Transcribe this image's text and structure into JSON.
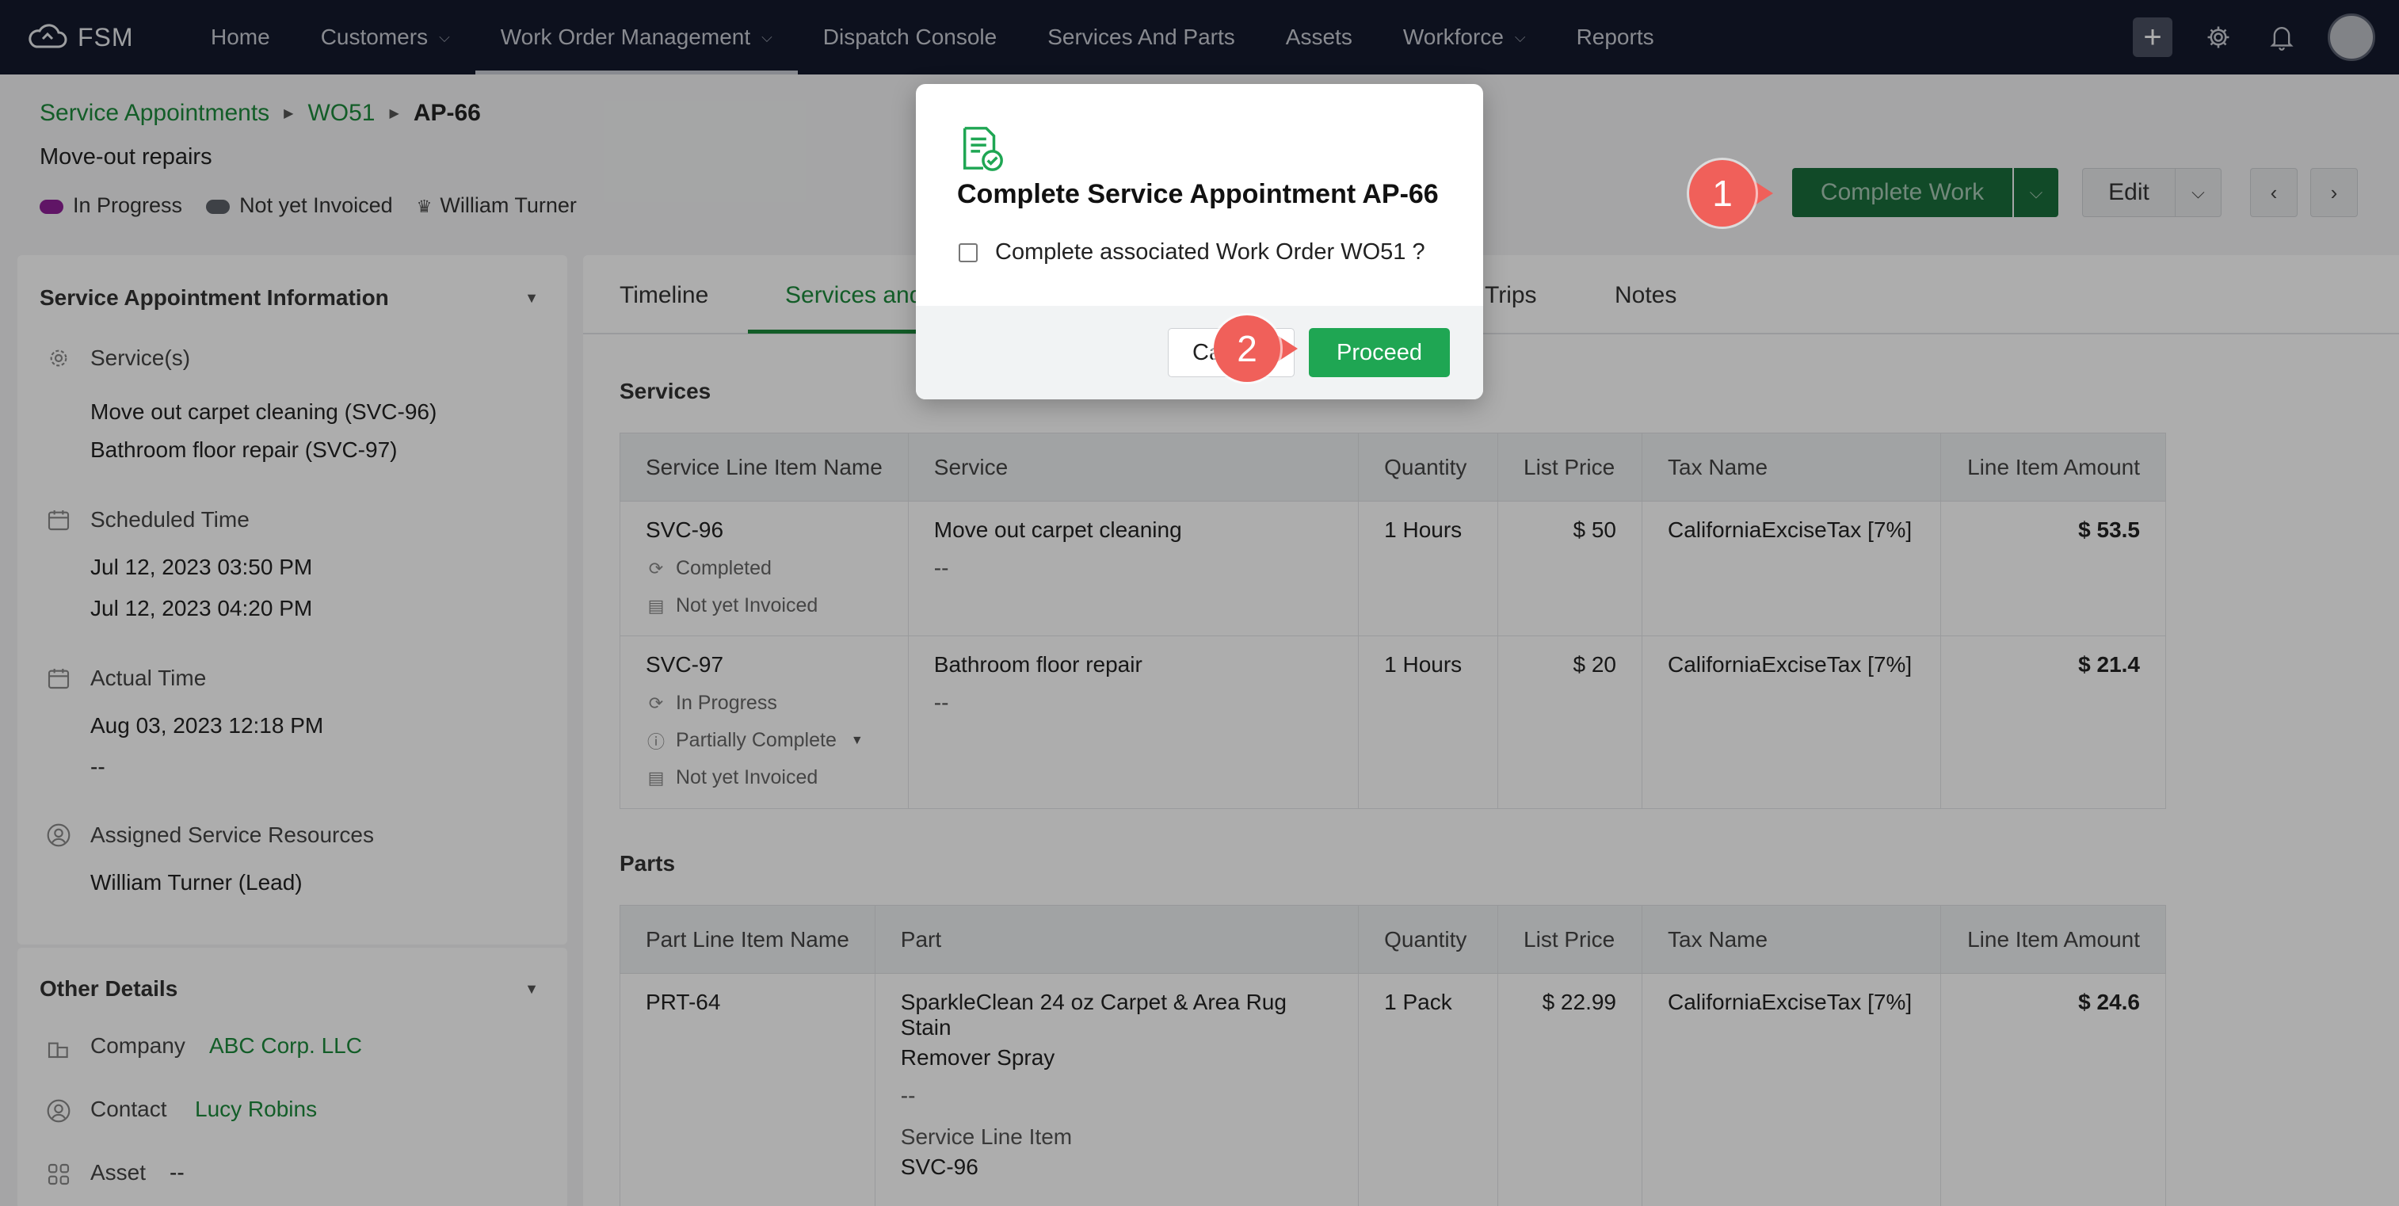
{
  "app": {
    "name": "FSM"
  },
  "nav": {
    "items": [
      {
        "label": "Home",
        "dropdown": false
      },
      {
        "label": "Customers",
        "dropdown": true
      },
      {
        "label": "Work Order Management",
        "dropdown": true,
        "active": true
      },
      {
        "label": "Dispatch Console",
        "dropdown": false
      },
      {
        "label": "Services And Parts",
        "dropdown": false
      },
      {
        "label": "Assets",
        "dropdown": false
      },
      {
        "label": "Workforce",
        "dropdown": true
      },
      {
        "label": "Reports",
        "dropdown": false
      }
    ],
    "plus_label": "+"
  },
  "breadcrumb": {
    "level1": "Service Appointments",
    "level2": "WO51",
    "current": "AP-66"
  },
  "header": {
    "subtitle": "Move-out repairs",
    "status": [
      {
        "label": "In Progress",
        "color": "#8e1f97"
      },
      {
        "label": "Not yet Invoiced",
        "color": "#5c6068"
      }
    ],
    "owner": "William Turner"
  },
  "actions": {
    "complete_work": "Complete Work",
    "edit": "Edit",
    "callout1": "1",
    "callout2": "2"
  },
  "left": {
    "section_title": "Service Appointment Information",
    "services_label": "Service(s)",
    "services": [
      "Move out carpet cleaning (SVC-96)",
      "Bathroom floor repair (SVC-97)"
    ],
    "scheduled_label": "Scheduled Time",
    "scheduled": [
      "Jul 12, 2023 03:50 PM",
      "Jul 12, 2023 04:20 PM"
    ],
    "actual_label": "Actual Time",
    "actual": [
      "Aug 03, 2023 12:18 PM",
      "--"
    ],
    "resources_label": "Assigned Service Resources",
    "resources": "William Turner (Lead)",
    "other_title": "Other Details",
    "company_label": "Company",
    "company_value": "ABC Corp. LLC",
    "contact_label": "Contact",
    "contact_value": "Lucy Robins",
    "asset_label": "Asset",
    "asset_value": "--"
  },
  "tabs": {
    "timeline": "Timeline",
    "services_parts": "Services and Parts",
    "trips": "Trips",
    "notes": "Notes"
  },
  "services_table": {
    "title": "Services",
    "headers": [
      "Service Line Item Name",
      "Service",
      "Quantity",
      "List Price",
      "Tax Name",
      "Line Item Amount"
    ],
    "rows": [
      {
        "name": "SVC-96",
        "status": "Completed",
        "invoice": "Not yet Invoiced",
        "service": "Move out carpet cleaning",
        "desc": "--",
        "qty": "1 Hours",
        "price": "$ 50",
        "tax": "CaliforniaExciseTax [7%]",
        "amount": "$ 53.5"
      },
      {
        "name": "SVC-97",
        "status": "In Progress",
        "sub_status": "Partially Complete",
        "invoice": "Not yet Invoiced",
        "service": "Bathroom floor repair",
        "desc": "--",
        "qty": "1 Hours",
        "price": "$ 20",
        "tax": "CaliforniaExciseTax [7%]",
        "amount": "$ 21.4"
      }
    ]
  },
  "parts_table": {
    "title": "Parts",
    "headers": [
      "Part Line Item Name",
      "Part",
      "Quantity",
      "List Price",
      "Tax Name",
      "Line Item Amount"
    ],
    "rows": [
      {
        "name": "PRT-64",
        "part_line1": "SparkleClean 24 oz Carpet & Area Rug Stain",
        "part_line2": "Remover Spray",
        "desc": "--",
        "sli_label": "Service Line Item",
        "sli_value": "SVC-96",
        "qty": "1 Pack",
        "price": "$ 22.99",
        "tax": "CaliforniaExciseTax [7%]",
        "amount": "$ 24.6"
      }
    ]
  },
  "modal": {
    "title": "Complete Service Appointment AP-66",
    "checkbox_label": "Complete associated Work Order WO51 ?",
    "cancel": "Cancel",
    "proceed": "Proceed"
  }
}
